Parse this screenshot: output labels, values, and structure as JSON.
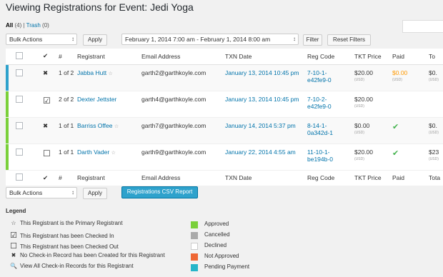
{
  "page": {
    "title": "Viewing Registrations for Event: Jedi Yoga",
    "views": {
      "all_label": "All",
      "all_count": "(4)",
      "separator": "|",
      "trash_label": "Trash",
      "trash_count": "(0)"
    }
  },
  "top_controls": {
    "bulk_actions": "Bulk Actions",
    "apply_label": "Apply",
    "date_range": "February 1, 2014 7:00 am - February 1, 2014 8:00 am",
    "filter_label": "Filter",
    "reset_label": "Reset Filters"
  },
  "table": {
    "columns": [
      "",
      "✔",
      "#",
      "Registrant",
      "Email Address",
      "TXN Date",
      "Reg Code",
      "TKT Price",
      "Paid",
      "Total"
    ],
    "header_labels": {
      "checkmark": "✔",
      "number": "#",
      "registrant": "Registrant",
      "email": "Email Address",
      "txn_date": "TXN Date",
      "reg_code": "Reg Code",
      "tkt_price": "TKT Price",
      "paid": "Paid",
      "total_top": "To",
      "total_bottom": "Tota"
    },
    "rows": [
      {
        "status_color": "#2ea2cc",
        "checkin": "✖",
        "number": "1 of 2",
        "registrant": "Jabba Hutt",
        "primary_star": "☆",
        "email": "garth2@garthkoyle.com",
        "txn_date": "January 13, 2014 10:45 pm",
        "reg_code_1": "7-10-1-",
        "reg_code_2": "e42fe9-0",
        "tkt_price": "$20.00",
        "tkt_currency": "(USD)",
        "paid": "$0.00",
        "paid_currency": "(USD)",
        "total": "$0.",
        "total_currency": "(USD)"
      },
      {
        "status_color": "#7ad03a",
        "checkin": "checked",
        "number": "2 of 2",
        "registrant": "Dexter Jettster",
        "primary_star": "",
        "email": "garth4@garthkoyle.com",
        "txn_date": "January 13, 2014 10:45 pm",
        "reg_code_1": "7-10-2-",
        "reg_code_2": "e42fe9-0",
        "tkt_price": "$20.00",
        "tkt_currency": "(USD)",
        "paid": "",
        "paid_currency": "",
        "total": "",
        "total_currency": ""
      },
      {
        "status_color": "#7ad03a",
        "checkin": "✖",
        "number": "1 of 1",
        "registrant": "Barriss Offee",
        "primary_star": "☆",
        "email": "garth7@garthkoyle.com",
        "txn_date": "January 14, 2014 5:37 pm",
        "reg_code_1": "8-14-1-",
        "reg_code_2": "0a342d-1",
        "tkt_price": "$0.00",
        "tkt_currency": "(USD)",
        "paid": "✔",
        "paid_currency": "",
        "total": "$0.",
        "total_currency": "(USD)"
      },
      {
        "status_color": "#7ad03a",
        "checkin": "unchecked",
        "number": "1 of 1",
        "registrant": "Darth Vader",
        "primary_star": "☆",
        "email": "garth9@garthkoyle.com",
        "txn_date": "January 22, 2014 4:55 am",
        "reg_code_1": "11-10-1-",
        "reg_code_2": "be194b-0",
        "tkt_price": "$20.00",
        "tkt_currency": "(USD)",
        "paid": "✔",
        "paid_currency": "",
        "total": "$23",
        "total_currency": "(USD)"
      }
    ]
  },
  "bottom_controls": {
    "bulk_actions": "Bulk Actions",
    "apply_label": "Apply",
    "csv_label": "Registrations CSV Report"
  },
  "legend": {
    "title": "Legend",
    "icon_items": [
      {
        "icon": "☆",
        "label": "This Registrant is the Primary Registrant"
      },
      {
        "icon": "checkbox-checked",
        "label": "This Registrant has been Checked In"
      },
      {
        "icon": "checkbox-empty",
        "label": "This Registrant has been Checked Out"
      },
      {
        "icon": "✖",
        "label": "No Check-in Record has been Created for this Registrant"
      },
      {
        "icon": "🔍",
        "label": "View All Check-in Records for this Registrant"
      }
    ],
    "status_items": [
      {
        "color": "#7ad03a",
        "label": "Approved"
      },
      {
        "color": "#aaaaaa",
        "label": "Cancelled"
      },
      {
        "color": "#ffffff",
        "label": "Declined"
      },
      {
        "color": "#ee6633",
        "label": "Not Approved"
      },
      {
        "color": "#26b5c9",
        "label": "Pending Payment"
      }
    ]
  }
}
